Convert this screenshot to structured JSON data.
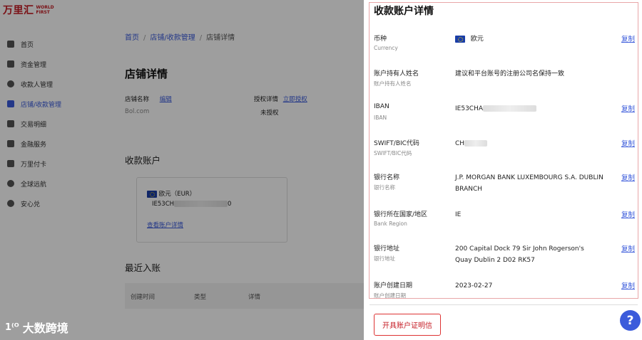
{
  "logo": {
    "cn": "万里汇",
    "en": "WORLD FIRST"
  },
  "sidebar": {
    "items": [
      {
        "label": "首页",
        "icon": "home-icon",
        "active": false
      },
      {
        "label": "资金管理",
        "icon": "funds-icon",
        "active": false
      },
      {
        "label": "收款人管理",
        "icon": "payee-icon",
        "active": false
      },
      {
        "label": "店铺/收款管理",
        "icon": "store-icon",
        "active": true
      },
      {
        "label": "交易明细",
        "icon": "transactions-icon",
        "active": false
      },
      {
        "label": "金融服务",
        "icon": "finance-icon",
        "active": false
      },
      {
        "label": "万里付卡",
        "icon": "card-icon",
        "active": false
      },
      {
        "label": "全球远航",
        "icon": "globe-icon",
        "active": false
      },
      {
        "label": "安心兑",
        "icon": "exchange-icon",
        "active": false
      }
    ]
  },
  "breadcrumb": {
    "home": "首页",
    "store_mgmt": "店铺/收款管理",
    "current": "店铺详情"
  },
  "store": {
    "title": "店铺详情",
    "name_label": "店铺名称",
    "edit_label": "编辑",
    "name_value": "Bol.com",
    "auth_label": "授权详情",
    "auth_link": "立即授权",
    "auth_status": "未授权"
  },
  "receive_account": {
    "section_title": "收款账户",
    "currency": "欧元（EUR）",
    "iban_prefix": "IE53CH",
    "iban_suffix": "0",
    "view_details": "查看账户详情"
  },
  "recent": {
    "section_title": "最近入账",
    "columns": [
      "创建时间",
      "类型",
      "详情"
    ]
  },
  "watermark": {
    "logo": "1⁽ᴼ",
    "text": "大数跨境"
  },
  "panel": {
    "title": "收款账户详情",
    "copy_label": "复制",
    "fields": [
      {
        "label": "币种",
        "sub": "Currency",
        "value": "欧元",
        "copy": true
      },
      {
        "label": "账户持有人姓名",
        "sub": "账户持有人姓名",
        "value": "建议和平台账号的注册公司名保持一致",
        "copy": false
      },
      {
        "label": "IBAN",
        "sub": "IBAN",
        "value": "IE53CHA",
        "copy": true
      },
      {
        "label": "SWIFT/BIC代码",
        "sub": "SWIFT/BIC代码",
        "value": "CH",
        "copy": true
      },
      {
        "label": "银行名称",
        "sub": "银行名称",
        "value": "J.P. MORGAN BANK LUXEMBOURG S.A. DUBLIN BRANCH",
        "copy": true
      },
      {
        "label": "银行所在国家/地区",
        "sub": "Bank Region",
        "value": "IE",
        "copy": true
      },
      {
        "label": "银行地址",
        "sub": "银行地址",
        "value": "200 Capital Dock 79 Sir John Rogerson's Quay Dublin 2 D02 RK57",
        "copy": true
      },
      {
        "label": "账户创建日期",
        "sub": "账户创建日期",
        "value": "2023-02-27",
        "copy": true
      }
    ],
    "cert_button": "开具账户证明信",
    "help_button": "?"
  }
}
